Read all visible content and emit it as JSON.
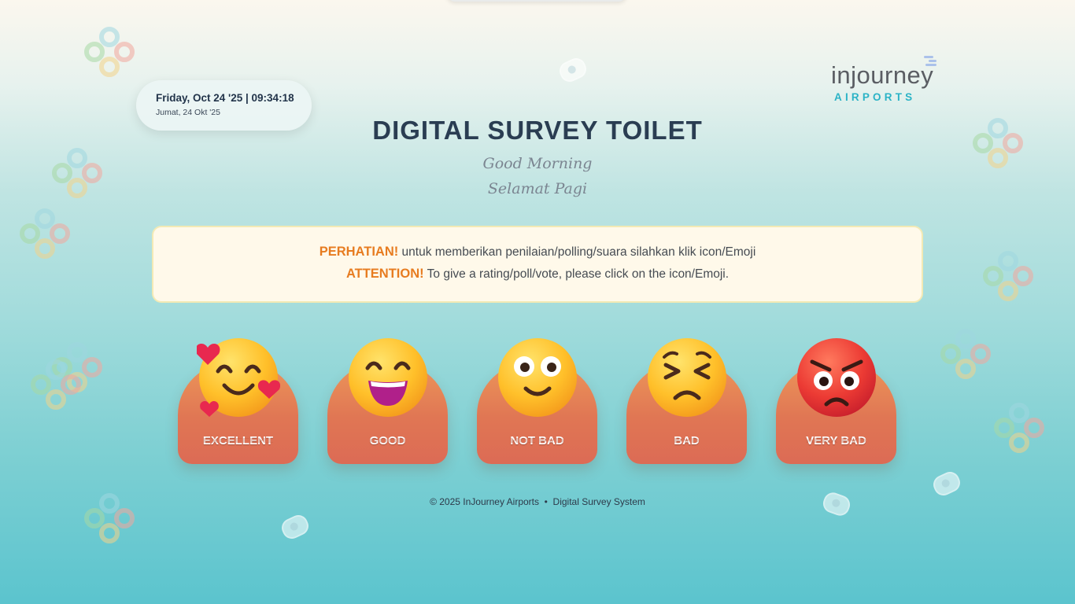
{
  "header": {
    "date_main": "Friday, Oct 24 '25 | 09:34:18",
    "date_local": "Jumat, 24 Okt '25"
  },
  "logo": {
    "wordmark": "injourney",
    "sub": "AIRPORTS",
    "brand_color": "#2bb3c6"
  },
  "title": "DIGITAL SURVEY TOILET",
  "greeting": {
    "en": "Good Morning",
    "id": "Selamat Pagi"
  },
  "notice": {
    "line1_label": "PERHATIAN!",
    "line1_text": " untuk memberikan penilaian/polling/suara silahkan klik icon/Emoji",
    "line2_label": "ATTENTION!",
    "line2_text": " To give a rating/poll/vote, please click on the icon/Emoji.",
    "accent_color": "#e77c20"
  },
  "ratings": [
    {
      "label": "EXCELLENT",
      "icon": "smiling-face-with-hearts-icon"
    },
    {
      "label": "GOOD",
      "icon": "grinning-face-icon"
    },
    {
      "label": "NOT BAD",
      "icon": "slightly-smiling-face-icon"
    },
    {
      "label": "BAD",
      "icon": "persevering-face-icon"
    },
    {
      "label": "VERY BAD",
      "icon": "angry-face-icon"
    }
  ],
  "footer": {
    "copyright": "© 2025 InJourney Airports",
    "separator": "•",
    "system": "Digital Survey System"
  }
}
